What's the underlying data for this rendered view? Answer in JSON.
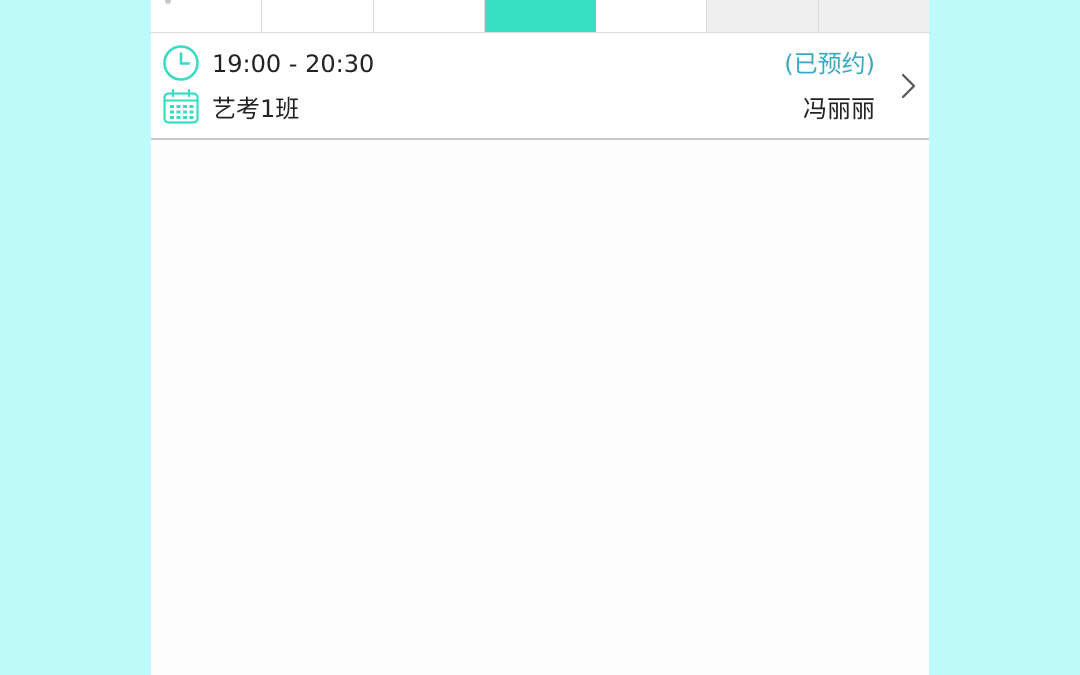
{
  "day_strip": {
    "cells": [
      {
        "state": "normal"
      },
      {
        "state": "normal"
      },
      {
        "state": "normal"
      },
      {
        "state": "selected"
      },
      {
        "state": "normal"
      },
      {
        "state": "disabled"
      },
      {
        "state": "disabled"
      }
    ]
  },
  "class_item": {
    "time": "19:00 - 20:30",
    "status": "(已预约)",
    "class_name": "艺考1班",
    "teacher": "冯丽丽",
    "icons": {
      "time": "clock-icon",
      "class": "calendar-icon",
      "action": "chevron-right-icon"
    }
  },
  "colors": {
    "background": "#bdfaf8",
    "accent": "#38e0c4",
    "status": "#3aa8c6"
  }
}
